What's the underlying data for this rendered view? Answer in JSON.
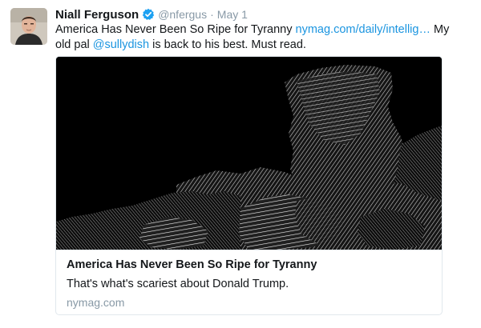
{
  "tweet": {
    "author": {
      "name": "Niall Ferguson",
      "handle": "@nfergus",
      "avatar_icon": "profile-photo",
      "verified_icon": "verified-badge-icon"
    },
    "separator": "·",
    "timestamp": "May 1",
    "text": {
      "part1": "America Has Never Been So Ripe for Tyranny ",
      "link_url": "nymag.com/daily/intellig…",
      "part2": " My old pal ",
      "mention": "@sullydish",
      "part3": " is back to his best. Must read."
    },
    "card": {
      "image_description": "black and white engraving-style illustration of a rocky landscape",
      "title": "America Has Never Been So Ripe for Tyranny",
      "description": "That's what's scariest about Donald Trump.",
      "domain": "nymag.com"
    }
  },
  "colors": {
    "link": "#1b95e0",
    "secondary_text": "#8899a6",
    "primary_text": "#14171a",
    "border": "#e1e8ed",
    "verified_badge": "#1da1f2"
  }
}
